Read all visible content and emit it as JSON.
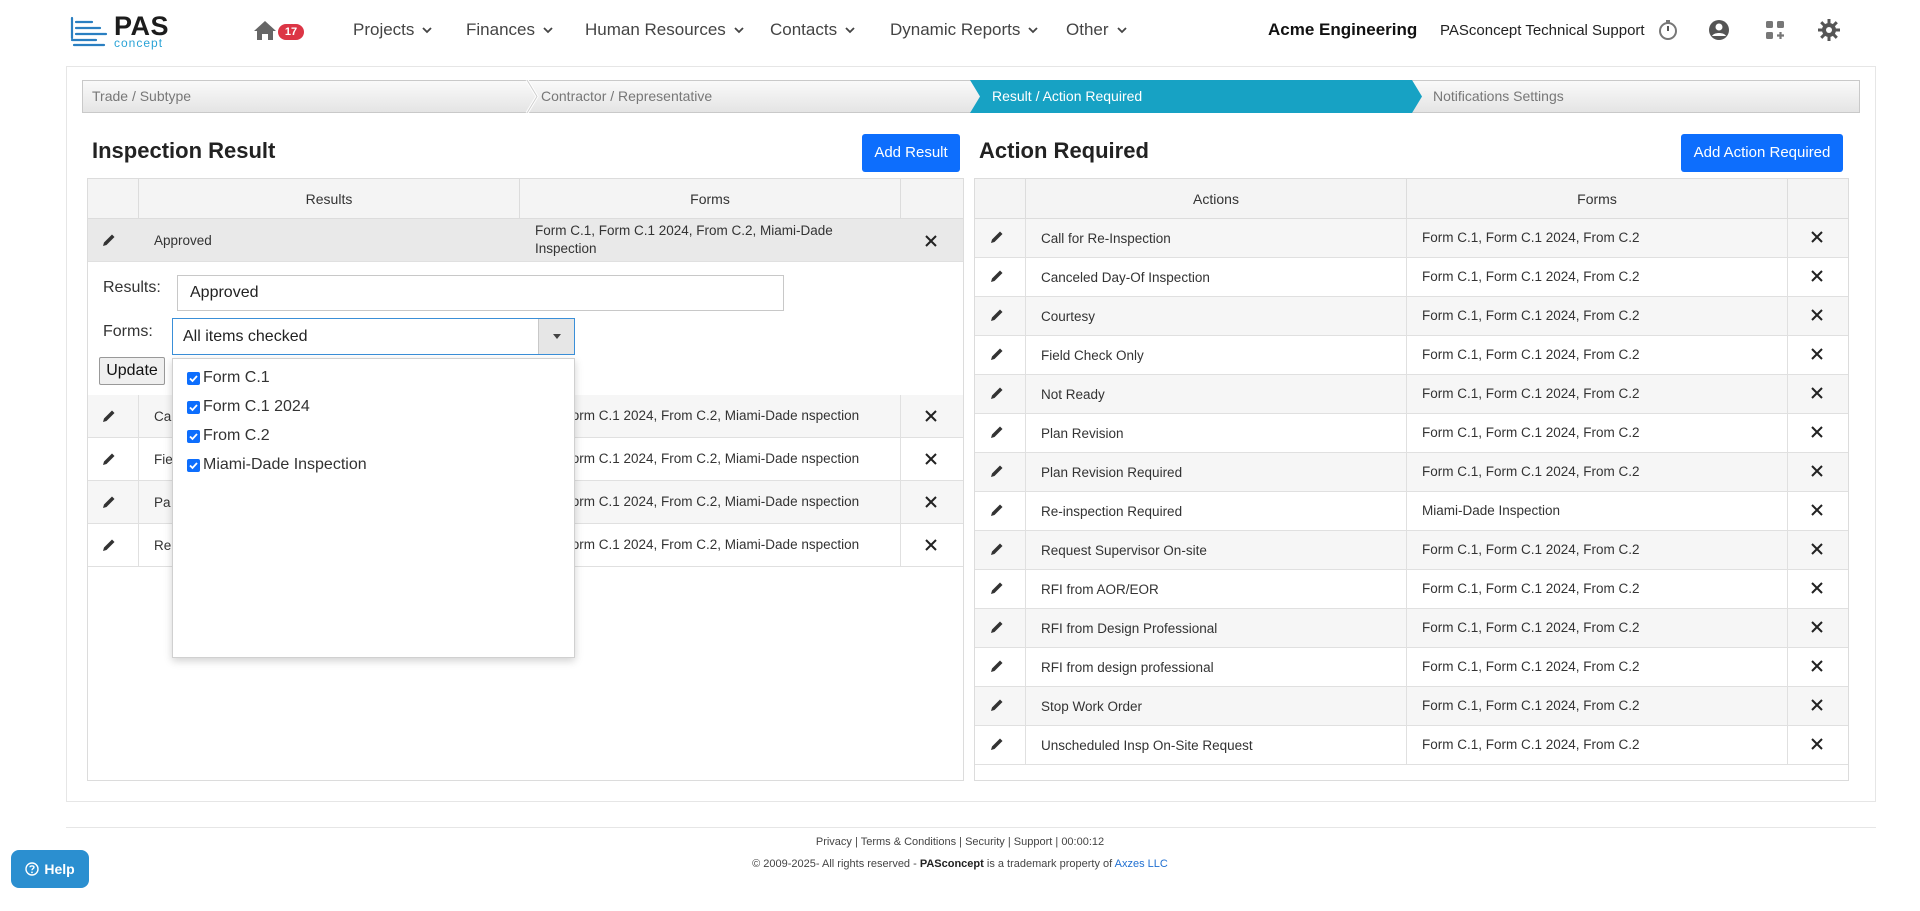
{
  "nav": {
    "logo_main": "PAS",
    "logo_sub": "concept",
    "home_badge": "17",
    "menus": [
      "Projects",
      "Finances",
      "Human Resources",
      "Contacts",
      "Dynamic Reports",
      "Other"
    ],
    "company": "Acme Engineering",
    "user": "PASconcept Technical Support",
    "icons": [
      "timer-icon",
      "user-icon",
      "apps-add-icon",
      "gear-icon"
    ]
  },
  "wizard": {
    "steps": [
      "Trade / Subtype",
      "Contractor / Representative",
      "Result / Action Required",
      "Notifications Settings"
    ],
    "active_index": 2,
    "active_color": "#17a2c4"
  },
  "left": {
    "title": "Inspection Result",
    "add_button": "Add Result",
    "col_results": "Results",
    "col_forms": "Forms",
    "rows": [
      {
        "result": "Approved",
        "forms": "Form C.1, Form C.1 2024, From C.2, Miami-Dade Inspection"
      },
      {
        "result": "Ca",
        "forms": "C.1, Form C.1 2024, From C.2, Miami-Dade nspection"
      },
      {
        "result": "Fie",
        "forms": "C.1, Form C.1 2024, From C.2, Miami-Dade nspection"
      },
      {
        "result": "Pa",
        "forms": "C.1, Form C.1 2024, From C.2, Miami-Dade nspection"
      },
      {
        "result": "Re",
        "forms": "C.1, Form C.1 2024, From C.2, Miami-Dade nspection"
      }
    ],
    "edit": {
      "results_label": "Results:",
      "results_value": "Approved",
      "forms_label": "Forms:",
      "forms_value": "All items checked",
      "update_button": "Update"
    },
    "dropdown_options": [
      {
        "label": "Form C.1",
        "checked": true
      },
      {
        "label": "Form C.1 2024",
        "checked": true
      },
      {
        "label": "From C.2",
        "checked": true
      },
      {
        "label": "Miami-Dade Inspection",
        "checked": true
      }
    ]
  },
  "right": {
    "title": "Action Required",
    "add_button": "Add Action Required",
    "col_actions": "Actions",
    "col_forms": "Forms",
    "rows": [
      {
        "action": "Call for Re-Inspection",
        "forms": "Form C.1, Form C.1 2024, From C.2"
      },
      {
        "action": "Canceled Day-Of Inspection",
        "forms": "Form C.1, Form C.1 2024, From C.2"
      },
      {
        "action": "Courtesy",
        "forms": "Form C.1, Form C.1 2024, From C.2"
      },
      {
        "action": "Field Check Only",
        "forms": "Form C.1, Form C.1 2024, From C.2"
      },
      {
        "action": "Not Ready",
        "forms": "Form C.1, Form C.1 2024, From C.2"
      },
      {
        "action": "Plan Revision",
        "forms": "Form C.1, Form C.1 2024, From C.2"
      },
      {
        "action": "Plan Revision Required",
        "forms": "Form C.1, Form C.1 2024, From C.2"
      },
      {
        "action": "Re-inspection Required",
        "forms": "Miami-Dade Inspection"
      },
      {
        "action": "Request Supervisor On-site",
        "forms": "Form C.1, Form C.1 2024, From C.2"
      },
      {
        "action": "RFI from AOR/EOR",
        "forms": "Form C.1, Form C.1 2024, From C.2"
      },
      {
        "action": "RFI from Design Professional",
        "forms": "Form C.1, Form C.1 2024, From C.2"
      },
      {
        "action": "RFI from design professional",
        "forms": "Form C.1, Form C.1 2024, From C.2"
      },
      {
        "action": "Stop Work Order",
        "forms": "Form C.1, Form C.1 2024, From C.2"
      },
      {
        "action": "Unscheduled Insp On-Site Request",
        "forms": "Form C.1, Form C.1 2024, From C.2"
      }
    ]
  },
  "footer": {
    "links": [
      "Privacy",
      "Terms & Conditions",
      "Security",
      "Support",
      "00:00:12"
    ],
    "copyright_pre": "© 2009-2025- All rights reserved - ",
    "brand": "PASconcept",
    "copyright_mid": " is a trademark property of ",
    "owner": "Axzes LLC",
    "help": "Help"
  }
}
